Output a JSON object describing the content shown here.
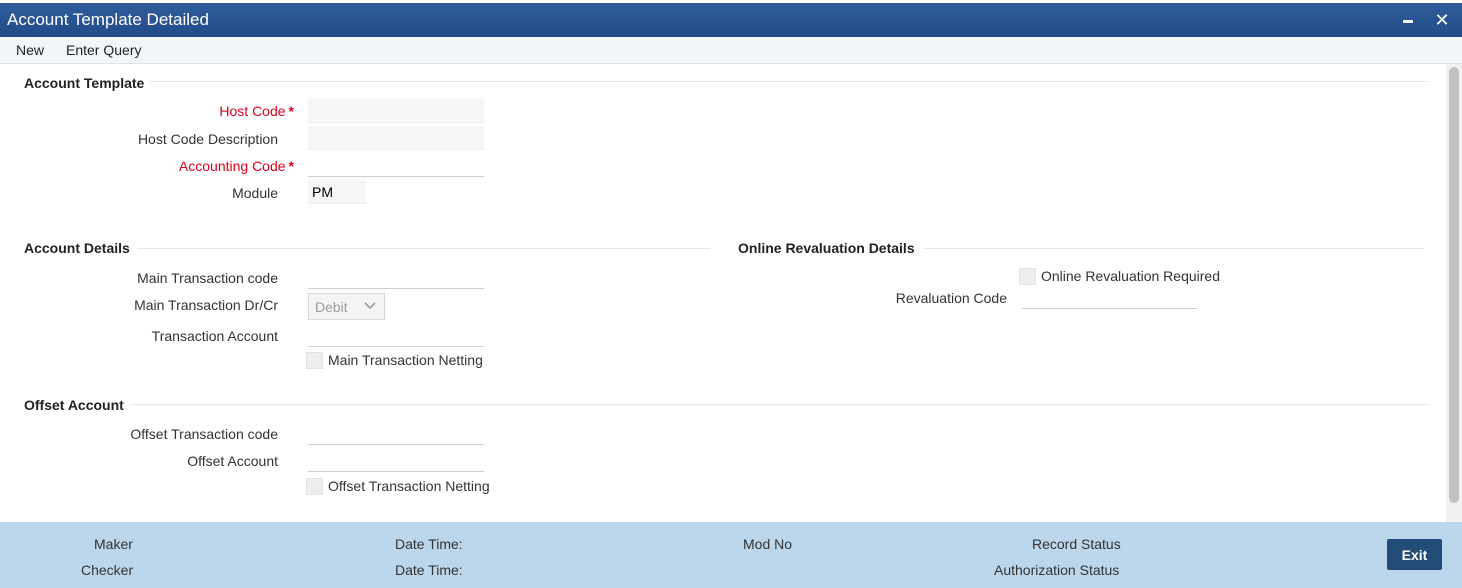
{
  "window": {
    "title": "Account Template Detailed",
    "minimize_icon": "minimize-icon",
    "close_glyph": "✕"
  },
  "menu": {
    "new_label": "New",
    "enter_query_label": "Enter Query"
  },
  "account_template": {
    "title": "Account Template",
    "host_code_label": "Host Code",
    "host_code_value": "",
    "host_code_description_label": "Host Code Description",
    "host_code_description_value": "",
    "accounting_code_label": "Accounting Code",
    "accounting_code_value": "",
    "module_label": "Module",
    "module_value": "PM",
    "required_mark": "*"
  },
  "account_details": {
    "title": "Account Details",
    "main_transaction_code_label": "Main Transaction code",
    "main_transaction_code_value": "",
    "main_transaction_drcr_label": "Main Transaction Dr/Cr",
    "main_transaction_drcr_value": "Debit",
    "transaction_account_label": "Transaction Account",
    "transaction_account_value": "",
    "main_transaction_netting_label": "Main Transaction Netting"
  },
  "online_revaluation": {
    "title": "Online Revaluation Details",
    "required_label": "Online Revaluation Required",
    "revaluation_code_label": "Revaluation Code",
    "revaluation_code_value": ""
  },
  "offset_account": {
    "title": "Offset Account",
    "offset_transaction_code_label": "Offset Transaction code",
    "offset_transaction_code_value": "",
    "offset_account_label": "Offset Account",
    "offset_account_value": "",
    "offset_transaction_netting_label": "Offset Transaction Netting"
  },
  "footer": {
    "maker_label": "Maker",
    "checker_label": "Checker",
    "date_time_label_1": "Date Time:",
    "date_time_label_2": "Date Time:",
    "mod_no_label": "Mod No",
    "record_status_label": "Record Status",
    "authorization_status_label": "Authorization Status",
    "exit_label": "Exit"
  },
  "colors": {
    "titlebar": "#2a5592",
    "required": "#e0001b",
    "footer": "#bcd7ec",
    "exit_button": "#234c77"
  }
}
